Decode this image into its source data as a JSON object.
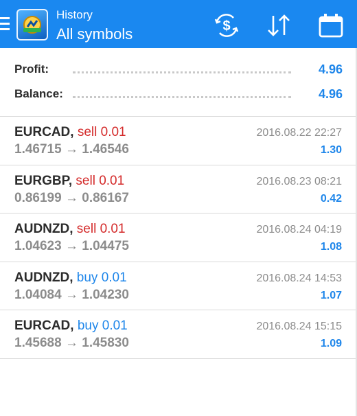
{
  "header": {
    "title": "History",
    "subtitle": "All symbols",
    "icons": {
      "menu": "hamburger-icon",
      "logo": "metatrader-logo",
      "deposits": "dollar-exchange-icon",
      "sort": "sort-arrows-icon",
      "period": "calendar-icon"
    }
  },
  "summary": {
    "profit_label": "Profit:",
    "profit_value": "4.96",
    "balance_label": "Balance:",
    "balance_value": "4.96"
  },
  "deals": [
    {
      "symbol": "EURCAD,",
      "action": "sell 0.01",
      "side": "sell",
      "open_price": "1.46715",
      "close_price": "1.46546",
      "time": "2016.08.22 22:27",
      "profit": "1.30"
    },
    {
      "symbol": "EURGBP,",
      "action": "sell 0.01",
      "side": "sell",
      "open_price": "0.86199",
      "close_price": "0.86167",
      "time": "2016.08.23 08:21",
      "profit": "0.42"
    },
    {
      "symbol": "AUDNZD,",
      "action": "sell 0.01",
      "side": "sell",
      "open_price": "1.04623",
      "close_price": "1.04475",
      "time": "2016.08.24 04:19",
      "profit": "1.08"
    },
    {
      "symbol": "AUDNZD,",
      "action": "buy 0.01",
      "side": "buy",
      "open_price": "1.04084",
      "close_price": "1.04230",
      "time": "2016.08.24 14:53",
      "profit": "1.07"
    },
    {
      "symbol": "EURCAD,",
      "action": "buy 0.01",
      "side": "buy",
      "open_price": "1.45688",
      "close_price": "1.45830",
      "time": "2016.08.24 15:15",
      "profit": "1.09"
    }
  ],
  "colors": {
    "app_bar": "#1a88f0",
    "profit_blue": "#1e86ea",
    "sell_red": "#d42a2a",
    "buy_blue": "#1e86ea"
  }
}
